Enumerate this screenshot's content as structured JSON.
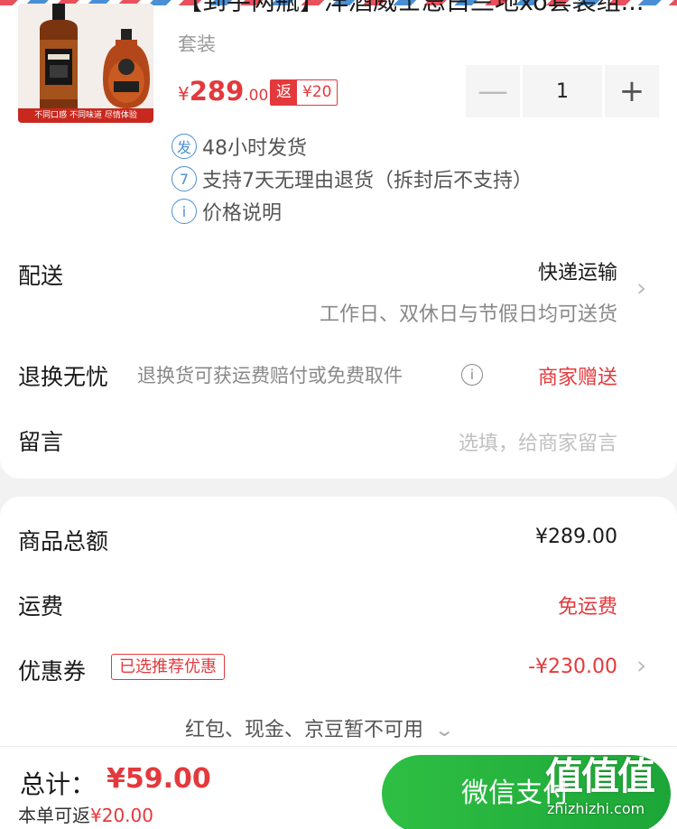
{
  "product": {
    "title": "【到手两瓶】洋酒威士忌白兰地xo套装组...",
    "spec": "套装",
    "price_currency": "¥",
    "price_integer": "289",
    "price_decimal": ".00",
    "rebate_tag": "返",
    "rebate_amount": "¥20",
    "image_caption": "不同口感 不同味道 尽情体验",
    "quantity": "1",
    "minus_label": "—",
    "plus_label": "+",
    "services": [
      {
        "icon": "发",
        "icon_name": "ship-icon",
        "text": "48小时发货"
      },
      {
        "icon": "7",
        "icon_name": "seven-day-return-icon",
        "text": "支持7天无理由退货（拆封后不支持）"
      },
      {
        "icon": "i",
        "icon_name": "info-icon",
        "text": "价格说明"
      }
    ]
  },
  "delivery": {
    "label": "配送",
    "method": "快递运输",
    "note": "工作日、双休日与节假日均可送货"
  },
  "returns": {
    "label": "退换无忧",
    "desc": "退换货可获运费赔付或免费取件",
    "value": "商家赠送"
  },
  "message": {
    "label": "留言",
    "placeholder": "选填，给商家留言"
  },
  "summary": {
    "goods_total_label": "商品总额",
    "goods_total": "¥289.00",
    "shipping_label": "运费",
    "shipping_value": "免运费",
    "coupon_label": "优惠券",
    "coupon_badge": "已选推荐优惠",
    "coupon_value": "-¥230.00",
    "unavailable": "红包、现金、京豆暂不可用"
  },
  "footer": {
    "total_label": "总计：",
    "total_value": "¥59.00",
    "rebate_prefix": "本单可返",
    "rebate_value": "¥20.00",
    "pay_button": "微信支付"
  },
  "watermark": {
    "glyphs": "值值值",
    "url": "zhizhizhi.com"
  },
  "colors": {
    "accent_red": "#e4393c",
    "pay_green": "#1ca637",
    "info_blue": "#4a90d9"
  }
}
